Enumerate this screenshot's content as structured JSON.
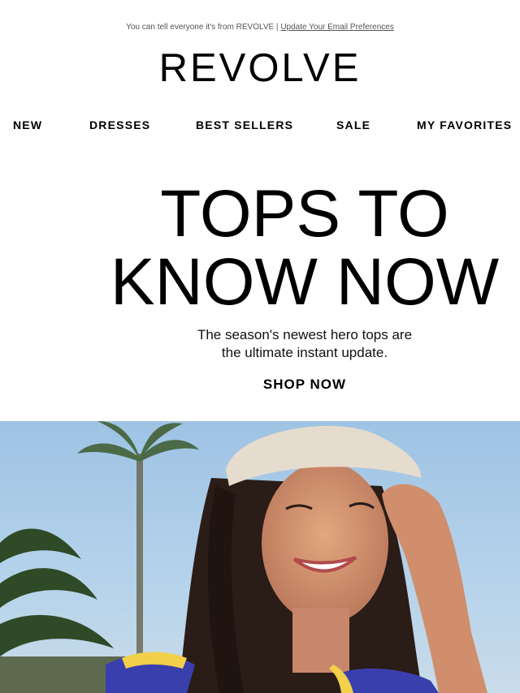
{
  "preheader": {
    "text": "You can tell everyone it's from REVOLVE | ",
    "link": "Update Your Email Preferences"
  },
  "brand": {
    "logo": "REVOLVE"
  },
  "nav": [
    {
      "label": "NEW"
    },
    {
      "label": "DRESSES"
    },
    {
      "label": "BEST SELLERS"
    },
    {
      "label": "SALE"
    },
    {
      "label": "MY FAVORITES"
    }
  ],
  "hero": {
    "headline_line1": "TOPS TO",
    "headline_line2": "KNOW NOW",
    "subtext_line1": "The season's newest hero tops are",
    "subtext_line2": "the ultimate instant update.",
    "cta": "SHOP NOW"
  },
  "colors": {
    "sky": "#a9cbe8",
    "cap": "#e6dccd",
    "top_blue": "#3a3fae",
    "top_yellow": "#f2d04a"
  }
}
